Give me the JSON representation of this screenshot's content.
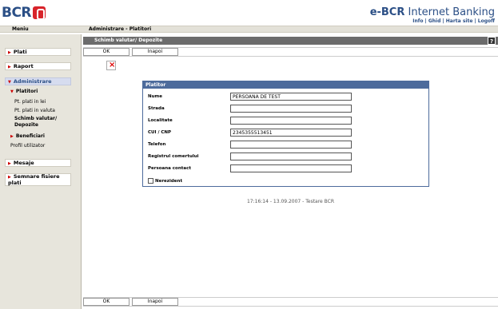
{
  "header": {
    "logo_text": "BCR",
    "brand_bold": "e-BCR",
    "brand_rest": " Internet Banking",
    "links": [
      "Info",
      "Ghid",
      "Harta site",
      "Logoff"
    ],
    "separator": " | "
  },
  "menubar": {
    "menu_label": "Meniu",
    "breadcrumb": "Administrare - Platitori"
  },
  "sidebar": {
    "sections": {
      "plati": "Plati",
      "raport": "Raport",
      "administrare": "Administrare",
      "mesaje": "Mesaje",
      "semnare": "Semnare fisiere plati"
    },
    "subsections": {
      "platitori": "Platitori",
      "beneficiari": "Beneficiari"
    },
    "items": {
      "lei": "Pt. plati in lei",
      "valuta": "Pt. plati in valuta",
      "schimb": "Schimb valutar/ Depozite",
      "profil": "Profil utilizator"
    }
  },
  "page": {
    "title": "Schimb valutar/ Depozite",
    "help": "?",
    "ok": "OK",
    "back": "Inapoi"
  },
  "form": {
    "title": "Platitor",
    "fields": {
      "nume": {
        "label": "Nume",
        "value": "PERSOANA DE TEST"
      },
      "strada": {
        "label": "Strada",
        "value": ""
      },
      "localitate": {
        "label": "Localitate",
        "value": ""
      },
      "cui": {
        "label": "CUI / CNP",
        "value": "2345355513451"
      },
      "telefon": {
        "label": "Telefon",
        "value": ""
      },
      "registrul": {
        "label": "Registrul comertului",
        "value": ""
      },
      "contact": {
        "label": "Persoana contact",
        "value": ""
      }
    },
    "nerezident": "Nerezident",
    "nerezident_checked": false
  },
  "footer": {
    "timestamp": "17:16:14 - 13.09.2007 - Testare BCR"
  },
  "colors": {
    "brand_blue": "#2b4f86",
    "logo_red": "#d8232a",
    "panel_header": "#4d6b9c",
    "title_bar": "#6c6c6c"
  }
}
